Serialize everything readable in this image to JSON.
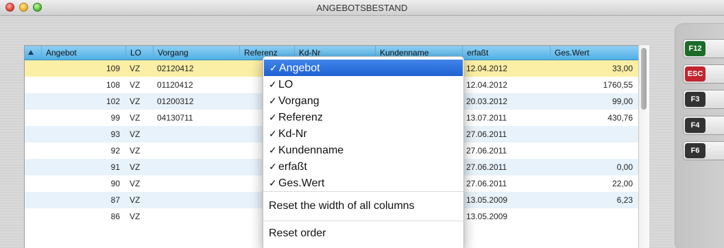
{
  "window": {
    "title": "ANGEBOTSBESTAND"
  },
  "table": {
    "headers": {
      "angebot": "Angebot",
      "lo": "LO",
      "vorgang": "Vorgang",
      "referenz": "Referenz",
      "kdnr": "Kd-Nr",
      "kundenname": "Kundenname",
      "erfasst": "erfaßt",
      "geswert": "Ges.Wert"
    },
    "rows": [
      {
        "angebot": "109",
        "lo": "VZ",
        "vorgang": "02120412",
        "erfasst": "12.04.2012",
        "geswert": "33,00",
        "selected": true
      },
      {
        "angebot": "108",
        "lo": "VZ",
        "vorgang": "01120412",
        "erfasst": "12.04.2012",
        "geswert": "1760,55"
      },
      {
        "angebot": "102",
        "lo": "VZ",
        "vorgang": "01200312",
        "erfasst": "20.03.2012",
        "geswert": "99,00"
      },
      {
        "angebot": "99",
        "lo": "VZ",
        "vorgang": "04130711",
        "erfasst": "13.07.2011",
        "geswert": "430,76"
      },
      {
        "angebot": "93",
        "lo": "VZ",
        "vorgang": "",
        "erfasst": "27.06.2011",
        "geswert": ""
      },
      {
        "angebot": "92",
        "lo": "VZ",
        "vorgang": "",
        "erfasst": "27.06.2011",
        "geswert": ""
      },
      {
        "angebot": "91",
        "lo": "VZ",
        "vorgang": "",
        "erfasst": "27.06.2011",
        "geswert": "0,00"
      },
      {
        "angebot": "90",
        "lo": "VZ",
        "vorgang": "",
        "erfasst": "27.06.2011",
        "geswert": "22,00"
      },
      {
        "angebot": "87",
        "lo": "VZ",
        "vorgang": "",
        "erfasst": "13.05.2009",
        "geswert": "6,23"
      },
      {
        "angebot": "86",
        "lo": "VZ",
        "vorgang": "",
        "erfasst": "13.05.2009",
        "geswert": ""
      }
    ]
  },
  "context_menu": {
    "items": [
      {
        "label": "Angebot",
        "check": "✓",
        "selected": true
      },
      {
        "label": "LO",
        "check": "✓"
      },
      {
        "label": "Vorgang",
        "check": "✓"
      },
      {
        "label": "Referenz",
        "check": "✓"
      },
      {
        "label": "Kd-Nr",
        "check": "✓"
      },
      {
        "label": "Kundenname",
        "check": "✓"
      },
      {
        "label": "erfaßt",
        "check": "✓"
      },
      {
        "label": "Ges.Wert",
        "check": "✓"
      }
    ],
    "reset_width": "Reset the width of all columns",
    "reset_order": "Reset order"
  },
  "function_keys": [
    {
      "key": "F12",
      "color": "#1c6b2b"
    },
    {
      "key": "ESC",
      "color": "#c3242f"
    },
    {
      "key": "F3",
      "color": "#333333"
    },
    {
      "key": "F4",
      "color": "#333333"
    },
    {
      "key": "F6",
      "color": "#333333"
    }
  ],
  "colors": {
    "header_blue": "#4fb0e6",
    "selected_row": "#fbeea5",
    "stripe_row": "#e8f2fb",
    "menu_highlight": "#1f61d2"
  }
}
